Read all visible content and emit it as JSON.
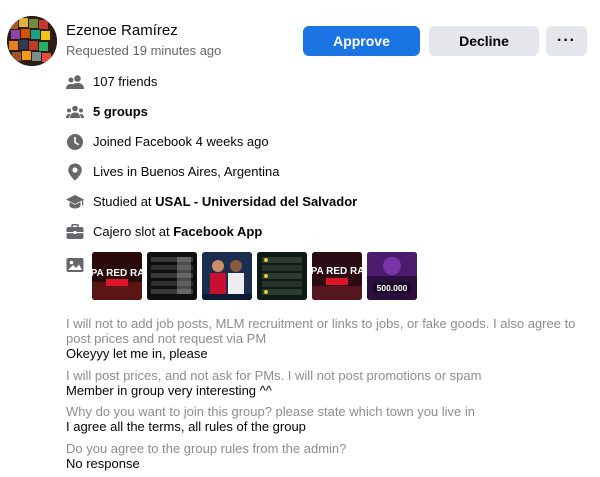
{
  "request": {
    "name": "Ezenoe Ramírez",
    "requested": "Requested 19 minutes ago"
  },
  "actions": {
    "approve": "Approve",
    "decline": "Decline",
    "more": "···"
  },
  "info": {
    "friends": "107 friends",
    "groups": "5 groups",
    "joined": "Joined Facebook 4 weeks ago",
    "lives_prefix": "Lives in ",
    "lives_place": "Buenos Aires, Argentina",
    "studied_prefix": "Studied at ",
    "studied_place": "USAL - Universidad del Salvador",
    "work_prefix": "Cajero slot at ",
    "work_place": "Facebook App"
  },
  "photos": [
    {
      "caption": "COPA RED RAKE",
      "bg": "#3b1010",
      "accent": "#e0132b"
    },
    {
      "caption": "",
      "bg": "#0f0f0f",
      "accent": "#d9d9d9"
    },
    {
      "caption": "",
      "bg": "#1c2d52",
      "accent": "#c8102e"
    },
    {
      "caption": "",
      "bg": "#101a14",
      "accent": "#e7c23a"
    },
    {
      "caption": "COPA RED RAKE",
      "bg": "#2a0c12",
      "accent": "#e0132b"
    },
    {
      "caption": "500.000",
      "bg": "#2a0f3e",
      "accent": "#ffffff"
    }
  ],
  "questions": [
    {
      "q": "I will not to add job posts, MLM recruitment or links to jobs, or fake goods. I also agree to post prices and not request via PM",
      "a": "Okeyyy let me in, please"
    },
    {
      "q": "I will post prices, and not ask for PMs. I will not post promotions or spam",
      "a": "Member in group very interesting ^^"
    },
    {
      "q": "Why do you want to join this group? please state which town you live in",
      "a": "I agree all the terms, all rules of the group"
    },
    {
      "q": "Do you agree to the group rules from the admin?",
      "a": "No response"
    }
  ],
  "colors": {
    "primary": "#1b74e4",
    "secondary_bg": "#e4e6eb",
    "icon": "#65676b",
    "muted_text": "#8a8d91"
  }
}
